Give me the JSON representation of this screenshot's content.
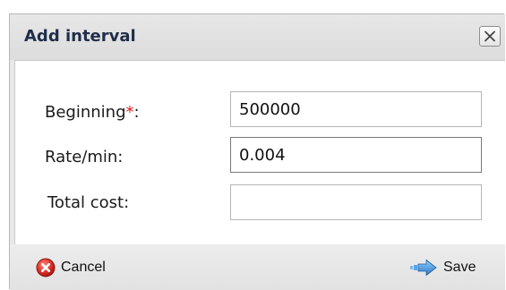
{
  "dialog": {
    "title": "Add interval",
    "close_icon": "close-icon"
  },
  "form": {
    "beginning_label": "Beginning",
    "required_marker": "*",
    "label_colon": ":",
    "beginning_value": "500000",
    "rate_label": "Rate/min:",
    "rate_value": "0.004",
    "total_label": "Total cost:",
    "total_value": ""
  },
  "footer": {
    "cancel_label": "Cancel",
    "cancel_icon": "cancel-icon",
    "save_label": "Save",
    "save_icon": "arrow-right-icon"
  },
  "colors": {
    "title_text": "#1f2e4a",
    "required": "#e21818",
    "cancel_icon": "#d9302c",
    "save_icon": "#3a8fde"
  }
}
